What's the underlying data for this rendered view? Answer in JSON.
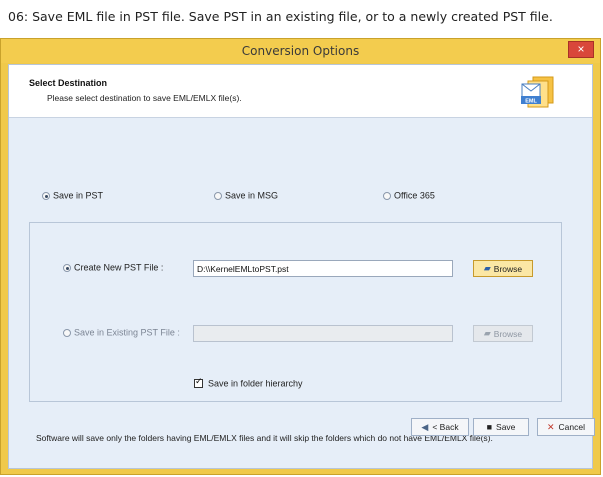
{
  "caption": "06: Save EML file in PST file. Save PST in an existing file, or to a newly created PST file.",
  "window": {
    "title": "Conversion Options",
    "close_symbol": "×"
  },
  "header": {
    "title": "Select Destination",
    "subtitle": "Please select destination to save EML/EMLX file(s).",
    "icon_label": "EML",
    "icon": "eml-file-icon"
  },
  "save_options": [
    {
      "label": "Save in PST",
      "selected": true
    },
    {
      "label": "Save in MSG",
      "selected": false
    },
    {
      "label": "Office 365",
      "selected": false
    }
  ],
  "create_new": {
    "label": "Create New PST File :",
    "selected": true,
    "path_value": "D:\\\\KernelEMLtoPST.pst",
    "browse_label": "Browse"
  },
  "existing": {
    "label": "Save in Existing PST File :",
    "selected": false,
    "path_value": "",
    "browse_label": "Browse"
  },
  "folder_hierarchy": {
    "label": "Save in folder hierarchy",
    "checked": true
  },
  "note": "Software will save only the folders having EML/EMLX files and it will skip the folders which do not have EML/EMLX file(s).",
  "footer": {
    "back_label": "< Back",
    "save_label": "Save",
    "cancel_label": "Cancel"
  },
  "colors": {
    "title_bar": "#f3cc4e",
    "client_bg": "#e6eef8",
    "close_button": "#d9473a",
    "browse_button": "#fbe7a5"
  }
}
